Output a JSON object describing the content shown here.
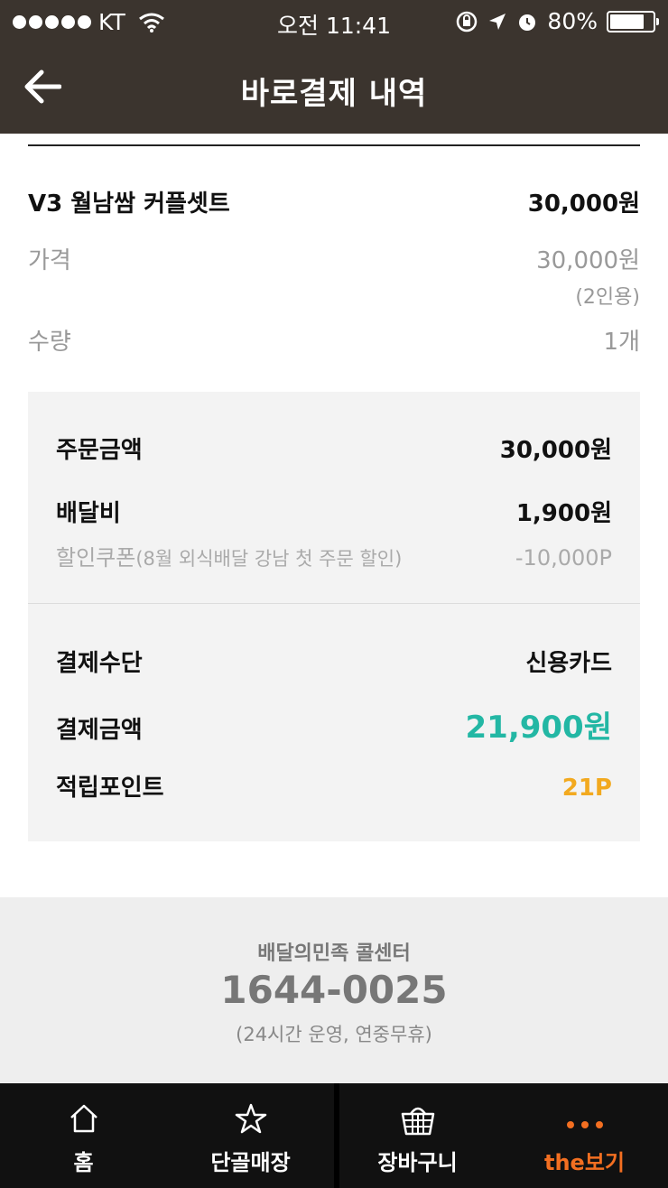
{
  "status_bar": {
    "carrier": "KT",
    "time": "오전 11:41",
    "battery_percent": "80%",
    "battery_level": 0.8
  },
  "nav": {
    "title": "바로결제 내역",
    "back_icon": "back-arrow-icon"
  },
  "order_item": {
    "name": "V3 월남쌈 커플셋트",
    "total": "30,000원",
    "price_label": "가격",
    "price_value": "30,000원",
    "price_note": "(2인용)",
    "qty_label": "수량",
    "qty_value": "1개"
  },
  "summary": {
    "order_amount_label": "주문금액",
    "order_amount_value": "30,000원",
    "delivery_fee_label": "배달비",
    "delivery_fee_value": "1,900원",
    "coupon_label": "할인쿠폰",
    "coupon_desc": "(8월 외식배달 강남 첫 주문 할인)",
    "coupon_value": "-10,000P",
    "payment_method_label": "결제수단",
    "payment_method_value": "신용카드",
    "payment_amount_label": "결제금액",
    "payment_amount_value": "21,900원",
    "points_label": "적립포인트",
    "points_value": "21P"
  },
  "callcenter": {
    "title": "배달의민족 콜센터",
    "phone": "1644-0025",
    "note": "(24시간 운영, 연중무휴)"
  },
  "tabs": [
    {
      "label": "홈",
      "icon": "home-icon"
    },
    {
      "label": "단골매장",
      "icon": "star-icon"
    },
    {
      "label": "장바구니",
      "icon": "basket-icon"
    },
    {
      "label": "the보기",
      "icon": "more-dots-icon"
    }
  ],
  "colors": {
    "header_bg": "#3b342e",
    "accent_teal": "#23b7a4",
    "accent_orange": "#f36f21",
    "points_yellow": "#f2a91f"
  }
}
